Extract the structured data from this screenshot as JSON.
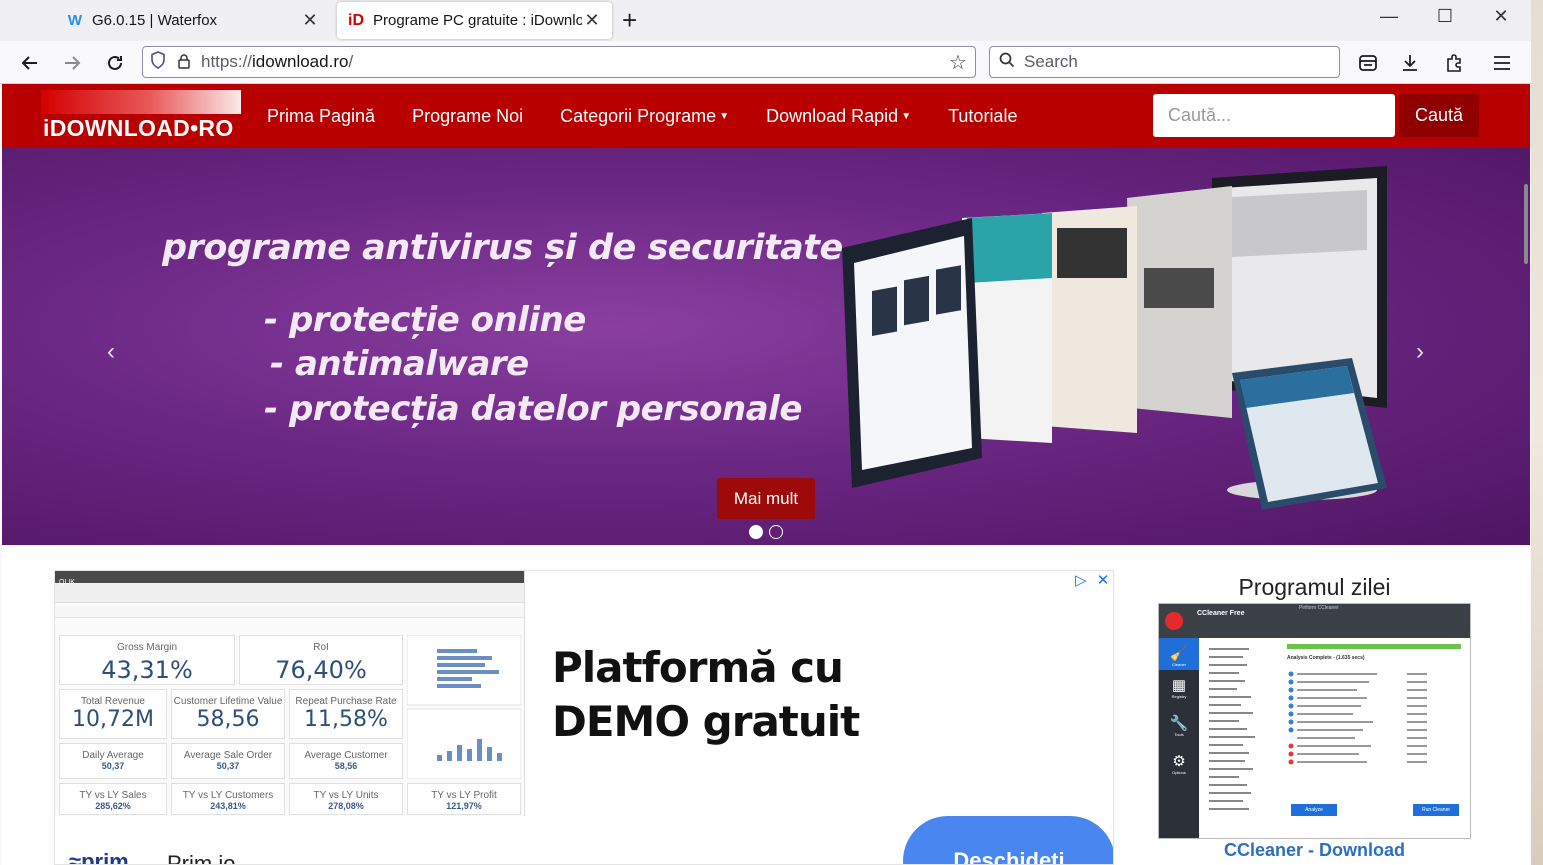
{
  "browser": {
    "tabs": [
      {
        "title": "G6.0.15 | Waterfox",
        "active": false,
        "favicon": "waterfox-icon"
      },
      {
        "title": "Programe PC gratuite : iDownlo",
        "active": true,
        "favicon": "idownload-icon"
      }
    ],
    "url_prefix": "https://",
    "url_domain": "idownload.ro",
    "url_path": "/",
    "search_placeholder": "Search"
  },
  "site": {
    "logo": "iDOWNLOAD•RO",
    "menu": [
      {
        "label": "Prima Pagină",
        "dropdown": false
      },
      {
        "label": "Programe Noi",
        "dropdown": false
      },
      {
        "label": "Categorii Programe",
        "dropdown": true
      },
      {
        "label": "Download Rapid",
        "dropdown": true
      },
      {
        "label": "Tutoriale",
        "dropdown": false
      }
    ],
    "search_placeholder": "Caută...",
    "search_button": "Caută"
  },
  "hero": {
    "title": "programe antivirus și de securitate",
    "lines": [
      "- protecție online",
      "- antimalware",
      "- protecția datelor personale"
    ],
    "button": "Mai mult",
    "slide_count": 2,
    "active_slide": 1
  },
  "ad": {
    "headline": "Platformă cu DEMO gratuit",
    "advertiser": "Prim.io",
    "cta": "Deschideți",
    "dashboard": {
      "brand": "QLIK",
      "kpis": [
        {
          "label": "Gross Margin",
          "value": "43,31%"
        },
        {
          "label": "RoI",
          "value": "76,40%"
        },
        {
          "label": "Total Revenue",
          "value": "10,72M"
        },
        {
          "label": "Customer Lifetime Value",
          "value": "58,56"
        },
        {
          "label": "Repeat Purchase Rate",
          "value": "11,58%"
        },
        {
          "label": "Daily Average",
          "value": "50,37"
        },
        {
          "label": "Average Sale Order",
          "value": "50,37"
        },
        {
          "label": "Average Customer",
          "value": "58,56"
        },
        {
          "label": "TY vs LY Sales",
          "value": "285,62%"
        },
        {
          "label": "TY vs LY Customers",
          "value": "243,81%"
        },
        {
          "label": "TY vs LY Units",
          "value": "278,08%"
        },
        {
          "label": "TY vs LY Profit",
          "value": "121,97%"
        }
      ]
    }
  },
  "sidebar": {
    "title": "Programul zilei",
    "link": "CCleaner - Download",
    "screenshot": {
      "app": "CCleaner Free",
      "window_title": "Piriform CCleaner",
      "status": "Analysis Complete - (1.635 secs)",
      "nav": [
        "Cleaner",
        "Registry",
        "Tools",
        "Options"
      ],
      "analyze_btn": "Analyze",
      "run_btn": "Run Cleaner"
    }
  }
}
